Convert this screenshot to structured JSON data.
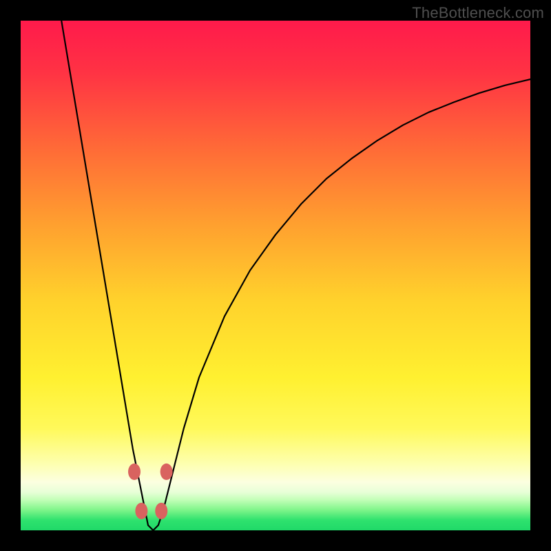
{
  "watermark": "TheBottleneck.com",
  "chart_data": {
    "type": "line",
    "title": "",
    "xlabel": "",
    "ylabel": "",
    "xlim": [
      0,
      100
    ],
    "ylim": [
      0,
      100
    ],
    "grid": false,
    "legend": false,
    "green_band": {
      "y_min": 0,
      "y_max": 6
    },
    "series": [
      {
        "name": "bottleneck-curve",
        "x": [
          8,
          10,
          12,
          14,
          16,
          18,
          20,
          22,
          24,
          25,
          26,
          27,
          28,
          30,
          32,
          35,
          40,
          45,
          50,
          55,
          60,
          65,
          70,
          75,
          80,
          85,
          90,
          95,
          100
        ],
        "y": [
          100,
          88,
          76,
          64,
          52,
          40,
          28,
          16,
          6,
          1,
          0,
          1,
          4,
          12,
          20,
          30,
          42,
          51,
          58,
          64,
          69,
          73,
          76.5,
          79.5,
          82,
          84,
          85.8,
          87.3,
          88.5
        ]
      }
    ],
    "markers": [
      {
        "x": 22.3,
        "y": 11.5
      },
      {
        "x": 28.6,
        "y": 11.5
      },
      {
        "x": 23.7,
        "y": 3.8
      },
      {
        "x": 27.6,
        "y": 3.8
      }
    ],
    "gradient_stops": [
      {
        "offset": 0.0,
        "color": "#ff1a4b"
      },
      {
        "offset": 0.1,
        "color": "#ff3244"
      },
      {
        "offset": 0.25,
        "color": "#ff6a37"
      },
      {
        "offset": 0.4,
        "color": "#ffa02f"
      },
      {
        "offset": 0.55,
        "color": "#ffd22c"
      },
      {
        "offset": 0.7,
        "color": "#fff030"
      },
      {
        "offset": 0.8,
        "color": "#fff95a"
      },
      {
        "offset": 0.87,
        "color": "#fdffb0"
      },
      {
        "offset": 0.905,
        "color": "#fcffe0"
      },
      {
        "offset": 0.925,
        "color": "#e8ffd8"
      },
      {
        "offset": 0.94,
        "color": "#c3ffb8"
      },
      {
        "offset": 0.96,
        "color": "#7ff58a"
      },
      {
        "offset": 0.98,
        "color": "#2fe26e"
      },
      {
        "offset": 1.0,
        "color": "#1fd968"
      }
    ]
  }
}
